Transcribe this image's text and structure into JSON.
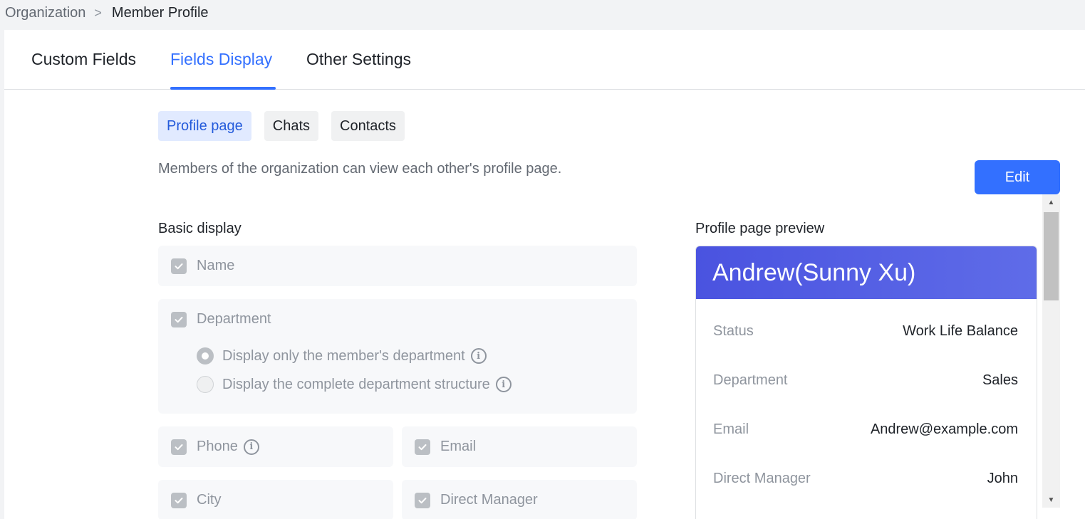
{
  "breadcrumb": {
    "parent": "Organization",
    "separator": ">",
    "current": "Member Profile"
  },
  "tabs": [
    {
      "label": "Custom Fields",
      "active": false
    },
    {
      "label": "Fields Display",
      "active": true
    },
    {
      "label": "Other Settings",
      "active": false
    }
  ],
  "subtabs": [
    {
      "label": "Profile page",
      "active": true
    },
    {
      "label": "Chats",
      "active": false
    },
    {
      "label": "Contacts",
      "active": false
    }
  ],
  "description": "Members of the organization can view each other's profile page.",
  "edit_label": "Edit",
  "basic_display": {
    "title": "Basic display",
    "name_label": "Name",
    "department_label": "Department",
    "department_options": [
      {
        "label": "Display only the member's department",
        "selected": true
      },
      {
        "label": "Display the complete department structure",
        "selected": false
      }
    ],
    "phone_label": "Phone",
    "email_label": "Email",
    "city_label": "City",
    "direct_manager_label": "Direct Manager"
  },
  "preview": {
    "title": "Profile page preview",
    "header_name": "Andrew(Sunny Xu)",
    "rows": [
      {
        "label": "Status",
        "value": "Work Life Balance"
      },
      {
        "label": "Department",
        "value": "Sales"
      },
      {
        "label": "Email",
        "value": "Andrew@example.com"
      },
      {
        "label": "Direct Manager",
        "value": "John"
      }
    ]
  },
  "icons": {
    "info": "info-icon",
    "checkbox": "check-icon",
    "breadcrumb_separator": "chevron-right-icon"
  },
  "colors": {
    "accent": "#3370ff",
    "preview_header": "#4a53e0",
    "disabled_checkbox": "#bbbfc4"
  }
}
